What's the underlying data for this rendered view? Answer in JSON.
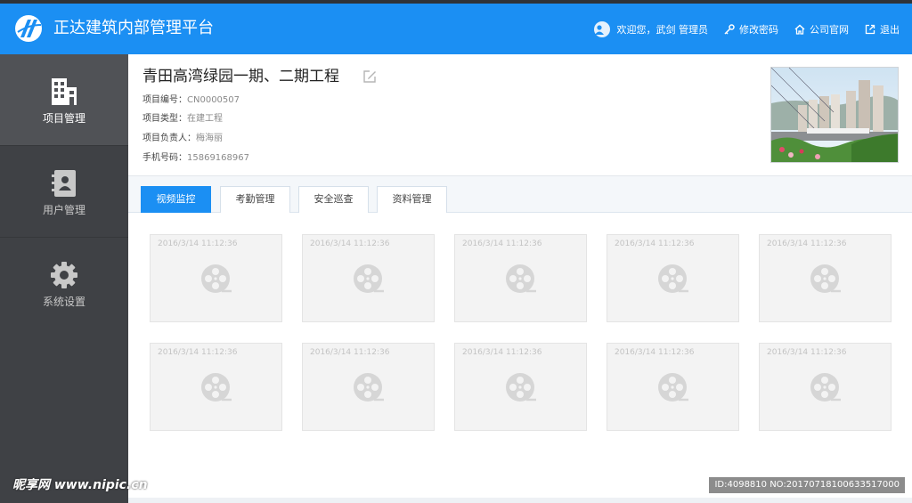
{
  "app": {
    "title": "正达建筑内部管理平台"
  },
  "header": {
    "greeting": "欢迎您，武剑 管理员",
    "change_password": "修改密码",
    "company_site": "公司官网",
    "logout": "退出"
  },
  "sidebar": {
    "items": [
      {
        "label": "项目管理",
        "icon": "building-icon",
        "active": true
      },
      {
        "label": "用户管理",
        "icon": "contacts-book-icon",
        "active": false
      },
      {
        "label": "系统设置",
        "icon": "gear-icon",
        "active": false
      }
    ]
  },
  "project": {
    "title": "青田高湾绿园一期、二期工程",
    "fields": [
      {
        "label": "项目编号：",
        "value": "CN0000507"
      },
      {
        "label": "项目类型：",
        "value": "在建工程"
      },
      {
        "label": "项目负责人：",
        "value": "梅海丽"
      },
      {
        "label": "手机号码：",
        "value": "15869168967"
      }
    ]
  },
  "tabs": [
    {
      "label": "视频监控",
      "active": true
    },
    {
      "label": "考勤管理",
      "active": false
    },
    {
      "label": "安全巡查",
      "active": false
    },
    {
      "label": "资料管理",
      "active": false
    }
  ],
  "videos": [
    {
      "timestamp": "2016/3/14 11:12:36"
    },
    {
      "timestamp": "2016/3/14 11:12:36"
    },
    {
      "timestamp": "2016/3/14 11:12:36"
    },
    {
      "timestamp": "2016/3/14 11:12:36"
    },
    {
      "timestamp": "2016/3/14 11:12:36"
    },
    {
      "timestamp": "2016/3/14 11:12:36"
    },
    {
      "timestamp": "2016/3/14 11:12:36"
    },
    {
      "timestamp": "2016/3/14 11:12:36"
    },
    {
      "timestamp": "2016/3/14 11:12:36"
    },
    {
      "timestamp": "2016/3/14 11:12:36"
    }
  ],
  "watermark": {
    "left": "昵享网 www.nipic.cn",
    "right": "ID:4098810 NO:20170718100633517000"
  },
  "colors": {
    "brand": "#1b8ff3",
    "sidebar_bg": "#3f4145",
    "sidebar_active": "#505256"
  }
}
